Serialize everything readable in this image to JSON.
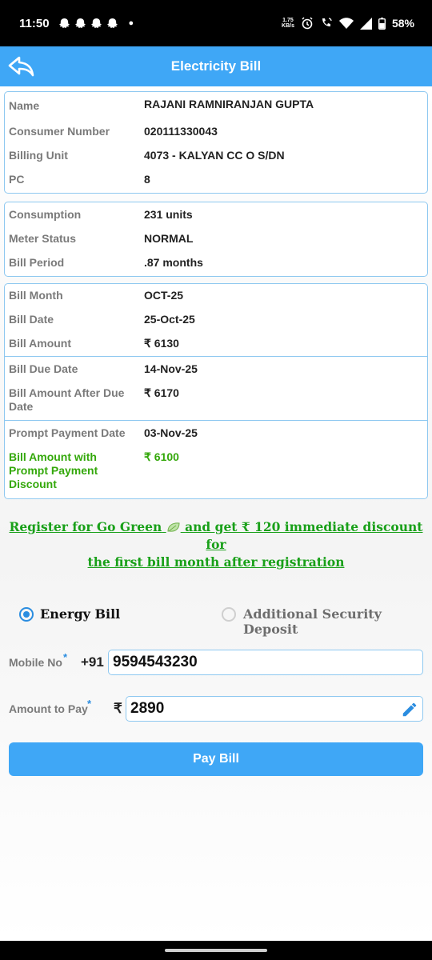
{
  "status_bar": {
    "time": "11:50",
    "net_speed_value": "1.75",
    "net_speed_unit": "KB/s",
    "battery": "58%",
    "icons": [
      "snapchat-icon",
      "snapchat-icon",
      "snapchat-icon",
      "snapchat-icon",
      "dot-icon",
      "alarm-icon",
      "wifi-calling-icon",
      "wifi-icon",
      "signal-icon",
      "battery-icon"
    ]
  },
  "app_bar": {
    "title": "Electricity Bill",
    "back_icon": "back-arrow-icon"
  },
  "consumer": [
    {
      "label": "Name",
      "value": "RAJANI RAMNIRANJAN GUPTA"
    },
    {
      "label": "Consumer Number",
      "value": "020111330043"
    },
    {
      "label": "Billing Unit",
      "value": "4073 - KALYAN CC O S/DN"
    },
    {
      "label": "PC",
      "value": "8"
    }
  ],
  "consumption": [
    {
      "label": "Consumption",
      "value": "231 units"
    },
    {
      "label": "Meter Status",
      "value": "NORMAL"
    },
    {
      "label": "Bill Period",
      "value": ".87 months"
    }
  ],
  "bill": [
    {
      "label": "Bill Month",
      "value": "OCT-25"
    },
    {
      "label": "Bill Date",
      "value": "25-Oct-25"
    },
    {
      "label": "Bill Amount",
      "value": "₹ 6130"
    },
    {
      "label": "Bill Due Date",
      "value": "14-Nov-25"
    },
    {
      "label": "Bill Amount After Due Date",
      "value": "₹ 6170"
    },
    {
      "label": "Prompt Payment Date",
      "value": "03-Nov-25"
    },
    {
      "label": "Bill Amount with Prompt Payment Discount",
      "value": "₹ 6100"
    }
  ],
  "go_green": {
    "line1_a": "Register for Go Green",
    "line1_b": "and get ₹ 120 immediate discount for",
    "line2": "the first bill month after registration",
    "icon": "leaf-icon"
  },
  "payment_type": {
    "options": [
      "Energy Bill",
      "Additional Security Deposit"
    ],
    "selected": "Energy Bill"
  },
  "form": {
    "mobile_label": "Mobile No",
    "mobile_prefix": "+91",
    "mobile_value": "9594543230",
    "amount_label": "Amount to Pay",
    "amount_prefix": "₹",
    "amount_value": "2890",
    "required_mark": "*",
    "edit_icon": "pencil-icon"
  },
  "pay_button": {
    "label": "Pay Bill"
  },
  "colors": {
    "accent": "#3fa7f6",
    "border": "#8ec8f0",
    "green": "#34a80b",
    "label_gray": "#7a7a7a"
  }
}
